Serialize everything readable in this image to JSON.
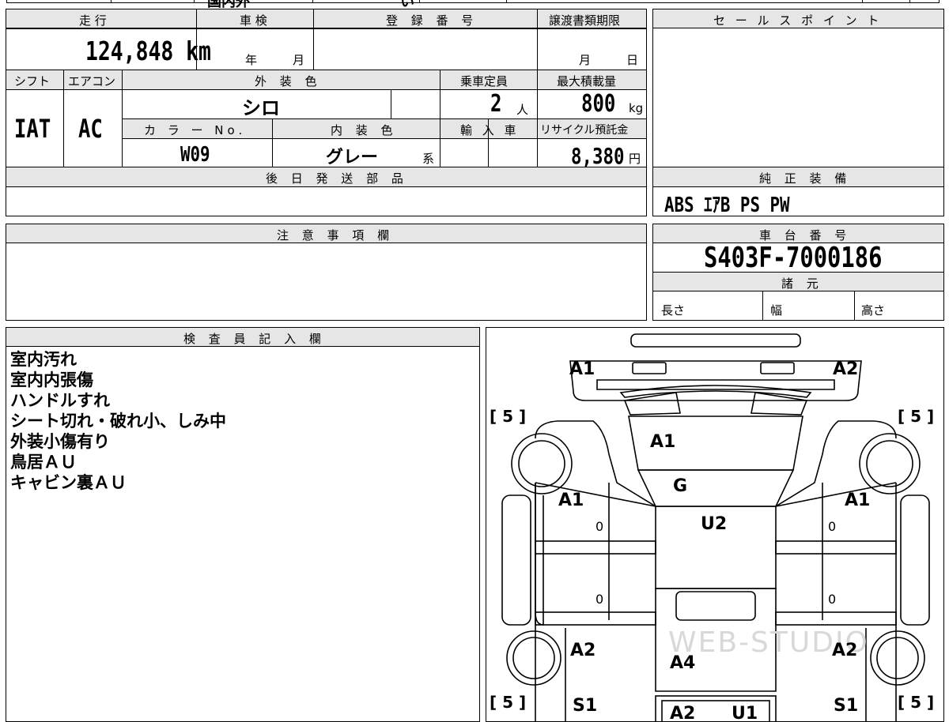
{
  "top_partial": {
    "a": "国内外",
    "b": "い"
  },
  "vehicle": {
    "mileage_label": "走 行",
    "mileage_value": "124,848 km",
    "inspection_label": "車 検",
    "inspection_year": "年",
    "inspection_month": "月",
    "reg_number_label": "登 録 番 号",
    "reg_number_value": "",
    "transfer_deadline_label": "譲渡書類期限",
    "transfer_month": "月",
    "transfer_day": "日",
    "shift_label": "シフト",
    "shift_value": "IAT",
    "ac_label": "エアコン",
    "ac_value": "AC",
    "exterior_color_label": "外 装 色",
    "exterior_color_value": "シロ",
    "capacity_label": "乗車定員",
    "capacity_value": "2",
    "capacity_unit": "人",
    "max_load_label": "最大積載量",
    "max_load_value": "800",
    "max_load_unit": "kg",
    "color_no_label": "カ ラ ー No.",
    "color_no_value": "W09",
    "interior_color_label": "内 装 色",
    "interior_color_value": "グレー",
    "interior_color_suffix": "系",
    "import_label": "輸 入 車",
    "recycle_label": "リサイクル預託金",
    "recycle_value": "8,380",
    "recycle_unit": "円",
    "later_parts_label": "後 日 発 送 部 品",
    "later_parts_value": ""
  },
  "sales_point": {
    "label": "セ ー ル ス ポ イ ン ト",
    "value": ""
  },
  "equipment": {
    "label": "純 正 装 備",
    "value": "ABS ｴｱB PS PW"
  },
  "notes": {
    "label": "注 意 事 項 欄",
    "value": ""
  },
  "chassis": {
    "label": "車 台 番 号",
    "value": "S403F-7000186"
  },
  "specs": {
    "label": "諸 元",
    "length": "長さ",
    "width": "幅",
    "height": "高さ"
  },
  "inspector": {
    "label": "検 査 員 記 入 欄",
    "lines": [
      "室内汚れ",
      "室内内張傷",
      "ハンドルすれ",
      "シート切れ・破れ小、しみ中",
      "外装小傷有り",
      "鳥居ＡＵ",
      "キャビン裏ＡＵ"
    ]
  },
  "diagram": {
    "labels": {
      "front_left": "A1",
      "front_right": "A2",
      "hood": "A1",
      "windshield": "G",
      "roof": "U2",
      "front_door_left": "A1",
      "front_door_right": "A1",
      "rear_left": "A2",
      "rear_right": "A2",
      "bed": "A4",
      "sill_left": "S1",
      "sill_right": "S1",
      "bottom_a": "A2",
      "bottom_b": "U1",
      "tire_fl": "[ 5 ]",
      "tire_fr": "[ 5 ]",
      "tire_rl": "[ 5 ]",
      "tire_rr": "[ 5 ]",
      "zero": "0"
    },
    "watermark": "WEB-STUDIO"
  }
}
